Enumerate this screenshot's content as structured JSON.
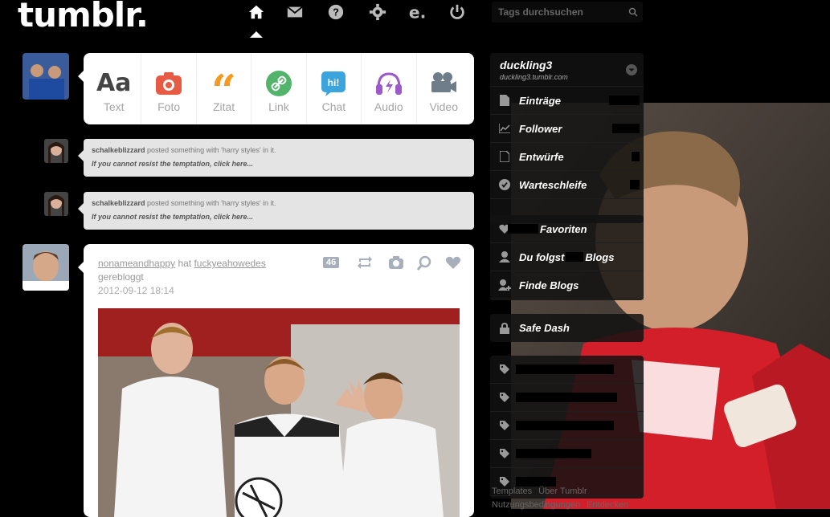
{
  "header": {
    "logo": "tumblr.",
    "search_placeholder": "Tags durchsuchen",
    "nav_icons": [
      "home-icon",
      "mail-icon",
      "help-icon",
      "settings-icon",
      "editor-icon",
      "power-icon"
    ]
  },
  "composer": {
    "types": [
      {
        "label": "Text",
        "icon": "text-icon",
        "color": "#444444"
      },
      {
        "label": "Foto",
        "icon": "photo-icon",
        "color": "#e75b44"
      },
      {
        "label": "Zitat",
        "icon": "quote-icon",
        "color": "#f49a21"
      },
      {
        "label": "Link",
        "icon": "link-icon",
        "color": "#52b46b"
      },
      {
        "label": "Chat",
        "icon": "chat-icon",
        "color": "#3ba4dd"
      },
      {
        "label": "Audio",
        "icon": "audio-icon",
        "color": "#9b59c9"
      },
      {
        "label": "Video",
        "icon": "video-icon",
        "color": "#6f7c89"
      }
    ]
  },
  "notes": [
    {
      "user": "schalkeblizzard",
      "text": "posted something with 'harry styles' in it.",
      "link": "If you cannot resist the temptation, click here..."
    },
    {
      "user": "schalkeblizzard",
      "text": "posted something with 'harry styles' in it.",
      "link": "If you cannot resist the temptation, click here..."
    }
  ],
  "post": {
    "user": "nonameandhappy",
    "hat": "hat",
    "source": "fuckyeahowedes",
    "reblogged": "gerebloggt",
    "date": "2012-09-12 18:14",
    "note_count": "46"
  },
  "sidebar": {
    "blog_name": "duckling3",
    "blog_url": "duckling3.tumblr.com",
    "blog_items": [
      {
        "label": "Einträge",
        "icon": "posts-icon"
      },
      {
        "label": "Follower",
        "icon": "followers-icon"
      },
      {
        "label": "Entwürfe",
        "icon": "drafts-icon"
      },
      {
        "label": "Warteschleife",
        "icon": "queue-icon"
      }
    ],
    "nav_items": [
      {
        "label": "Favoriten",
        "icon": "heart-icon"
      },
      {
        "label": "Du folgst",
        "suffix": "Blogs",
        "icon": "person-icon"
      },
      {
        "label": "Finde Blogs",
        "icon": "person-add-icon"
      }
    ],
    "safe_dash": "Safe Dash",
    "tags_count": 5
  },
  "footer": {
    "links": [
      "Templates",
      "Über Tumblr",
      "Nutzungsbedingungen",
      "Entdecken"
    ]
  }
}
